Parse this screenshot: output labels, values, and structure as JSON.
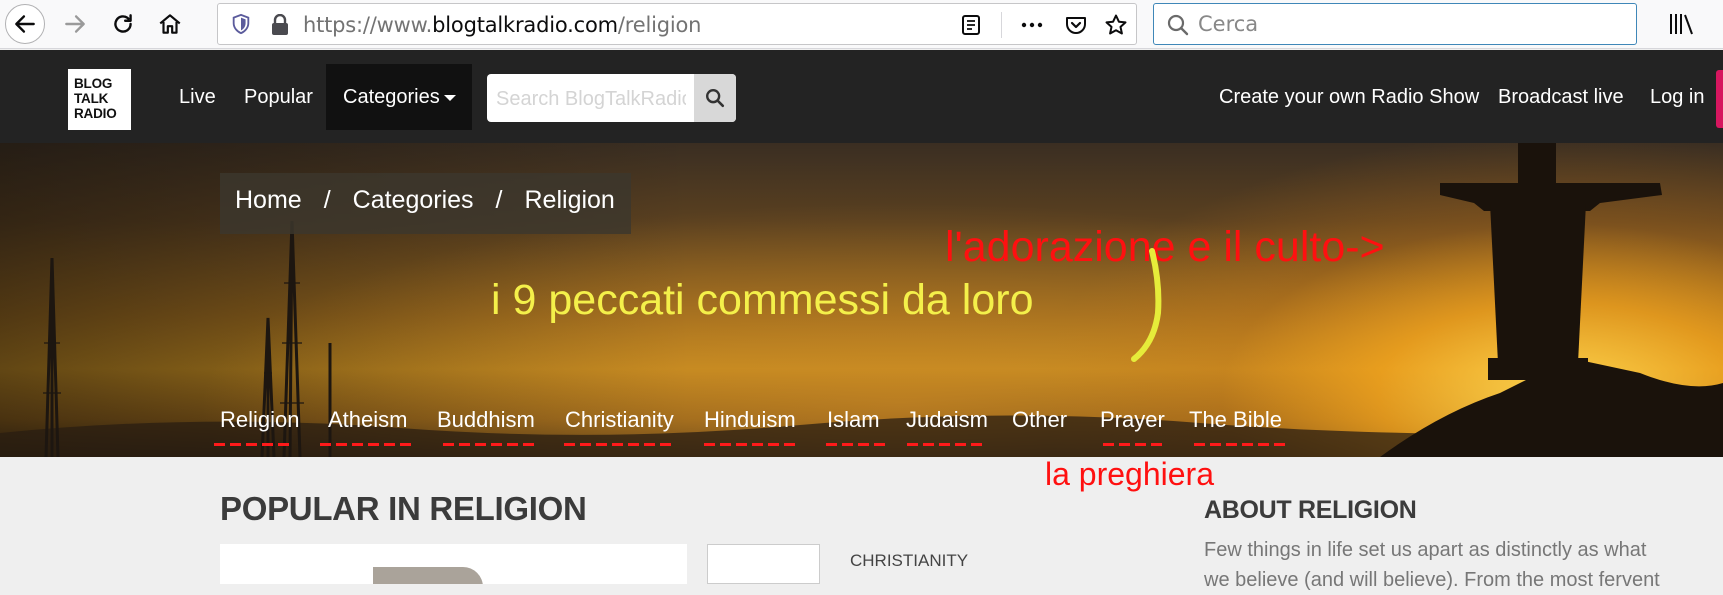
{
  "browser": {
    "url_prefix": "https://www.",
    "url_domain": "blogtalkradio.com",
    "url_path": "/religion",
    "search_placeholder": "Cerca"
  },
  "header": {
    "logo_lines": [
      "BLOG",
      "TALK",
      "RADIO"
    ],
    "nav": {
      "live": "Live",
      "popular": "Popular",
      "categories": "Categories"
    },
    "search_placeholder": "Search BlogTalkRadio",
    "right": {
      "create": "Create your own Radio Show",
      "broadcast": "Broadcast live",
      "login": "Log in"
    },
    "accent_color": "#d6165f"
  },
  "hero": {
    "breadcrumb": [
      "Home",
      "Categories",
      "Religion"
    ],
    "breadcrumb_sep": "/",
    "annotations": {
      "worship": "l'adorazione e il culto->",
      "sins": "i 9 peccati commessi da loro",
      "prayer": "la preghiera"
    },
    "subnav": [
      "Religion",
      "Atheism",
      "Buddhism",
      "Christianity",
      "Hinduism",
      "Islam",
      "Judaism",
      "Other",
      "Prayer",
      "The Bible"
    ]
  },
  "content": {
    "popular_title": "POPULAR IN RELIGION",
    "card_category": "CHRISTIANITY",
    "about_title": "ABOUT RELIGION",
    "about_text": "Few things in life set us apart as distinctly as what we believe (and will believe). From the most fervent"
  }
}
